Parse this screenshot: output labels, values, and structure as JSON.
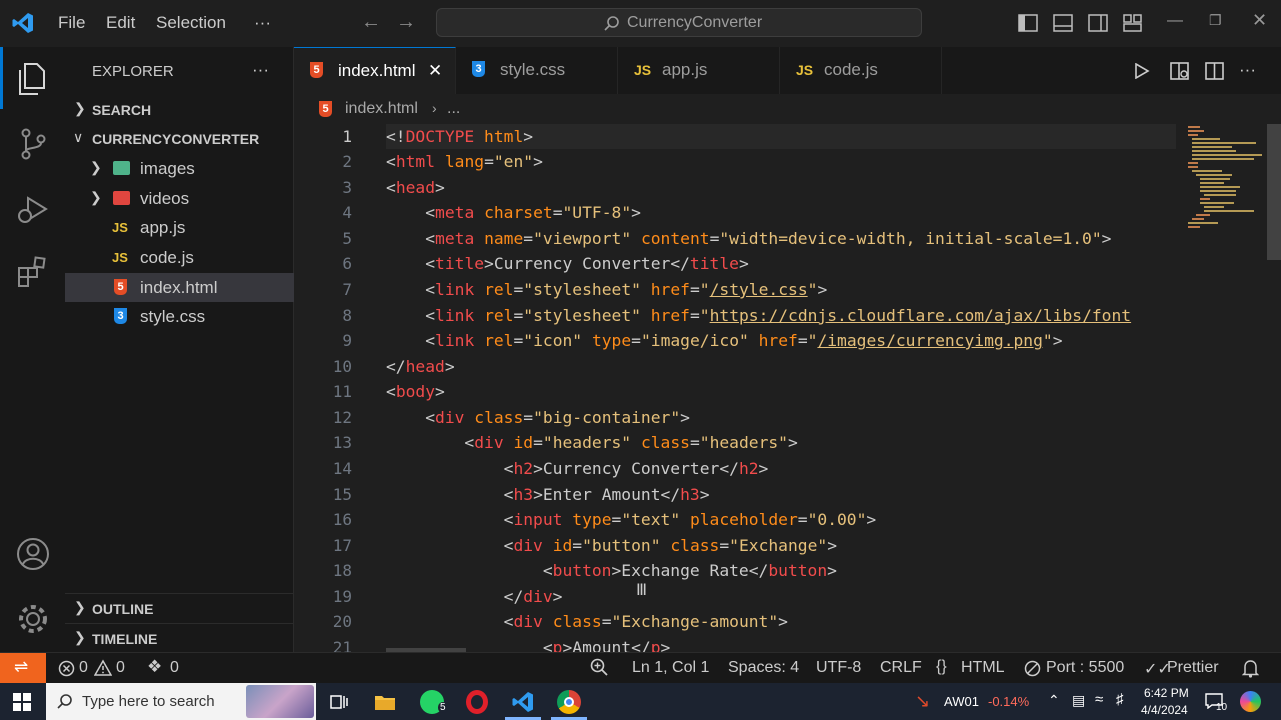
{
  "titlebar": {
    "menu": [
      "File",
      "Edit",
      "Selection",
      "···"
    ],
    "search_text": "CurrencyConverter"
  },
  "explorer": {
    "title": "EXPLORER",
    "more": "···",
    "search_label": "SEARCH",
    "project_label": "CURRENCYCONVERTER",
    "items": [
      {
        "label": "images",
        "icon": "image-folder-icon"
      },
      {
        "label": "videos",
        "icon": "video-folder-icon"
      },
      {
        "label": "app.js",
        "icon": "js-file-icon"
      },
      {
        "label": "code.js",
        "icon": "js-file-icon"
      },
      {
        "label": "index.html",
        "icon": "html-file-icon"
      },
      {
        "label": "style.css",
        "icon": "css-file-icon"
      }
    ],
    "outline_label": "OUTLINE",
    "timeline_label": "TIMELINE"
  },
  "tabs": [
    {
      "label": "index.html",
      "icon_text": "5"
    },
    {
      "label": "style.css",
      "icon_text": "3"
    },
    {
      "label": "app.js",
      "icon_text": "JS"
    },
    {
      "label": "code.js",
      "icon_text": "JS"
    }
  ],
  "breadcrumb": {
    "file": "index.html",
    "rest": "..."
  },
  "editor": {
    "line_numbers": [
      "1",
      "2",
      "3",
      "4",
      "5",
      "6",
      "7",
      "8",
      "9",
      "10",
      "11",
      "12",
      "13",
      "14",
      "15",
      "16",
      "17",
      "18",
      "19",
      "20",
      "21"
    ]
  },
  "statusbar": {
    "errors": "0",
    "warnings": "0",
    "ports": "0",
    "position": "Ln 1, Col 1",
    "spaces": "Spaces: 4",
    "encoding": "UTF-8",
    "eol": "CRLF",
    "language": "HTML",
    "port": "Port : 5500",
    "prettier": "Prettier"
  },
  "taskbar": {
    "search_placeholder": "Type here to search",
    "whatsapp_badge": "5",
    "stock_name": "AW01",
    "stock_change": "-0.14%",
    "time": "6:42 PM",
    "date": "4/4/2024",
    "notifications": "10"
  },
  "colors": {
    "accent": "#0078d4",
    "remote": "#f0641e",
    "tag": "#f14c4c",
    "attr": "#ff8c1a",
    "string": "#e5c07b"
  }
}
